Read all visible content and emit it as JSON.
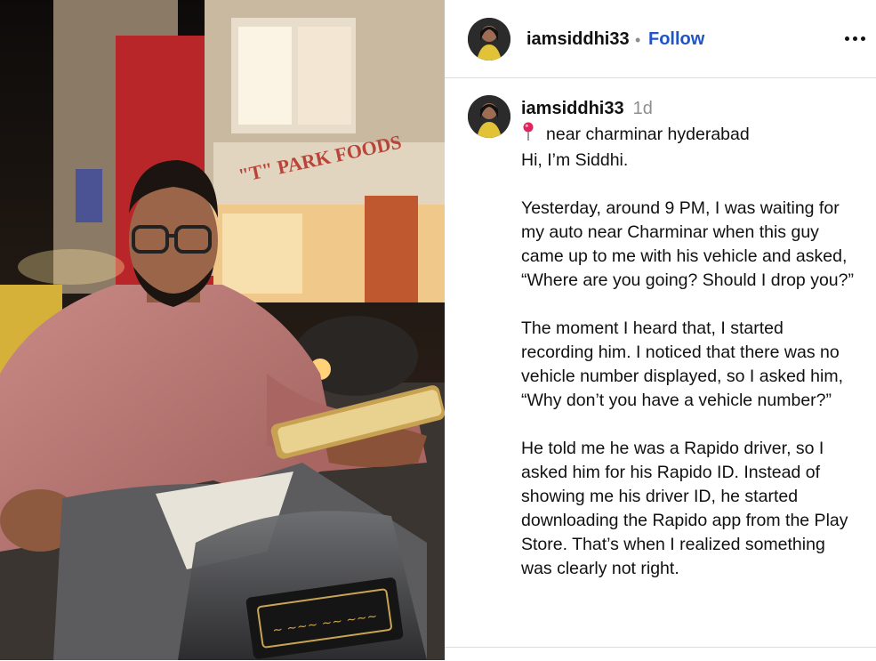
{
  "post": {
    "image_alt": "",
    "header": {
      "username": "iamsiddhi33",
      "separator": "•",
      "follow_label": "Follow",
      "more_icon": "more-horizontal-icon"
    },
    "caption": {
      "username": "iamsiddhi33",
      "time_ago": "1d",
      "location_icon": "round-pushpin-icon",
      "location": "near charminar hyderabad",
      "paragraphs": [
        "Hi, I’m Siddhi.",
        "Yesterday, around 9 PM, I was waiting for my auto near Charminar when this guy came up to me with his vehicle and asked, “Where are you going? Should I drop you?”",
        "The moment I heard that, I started recording him. I noticed that there was no vehicle number displayed, so I asked him, “Why don’t you have a vehicle number?”",
        "He told me he was a Rapido driver, so I asked him for his Rapido ID. Instead of showing me his driver ID, he started downloading the Rapido app from the Play Store. That’s when I realized something was clearly not right."
      ]
    }
  }
}
